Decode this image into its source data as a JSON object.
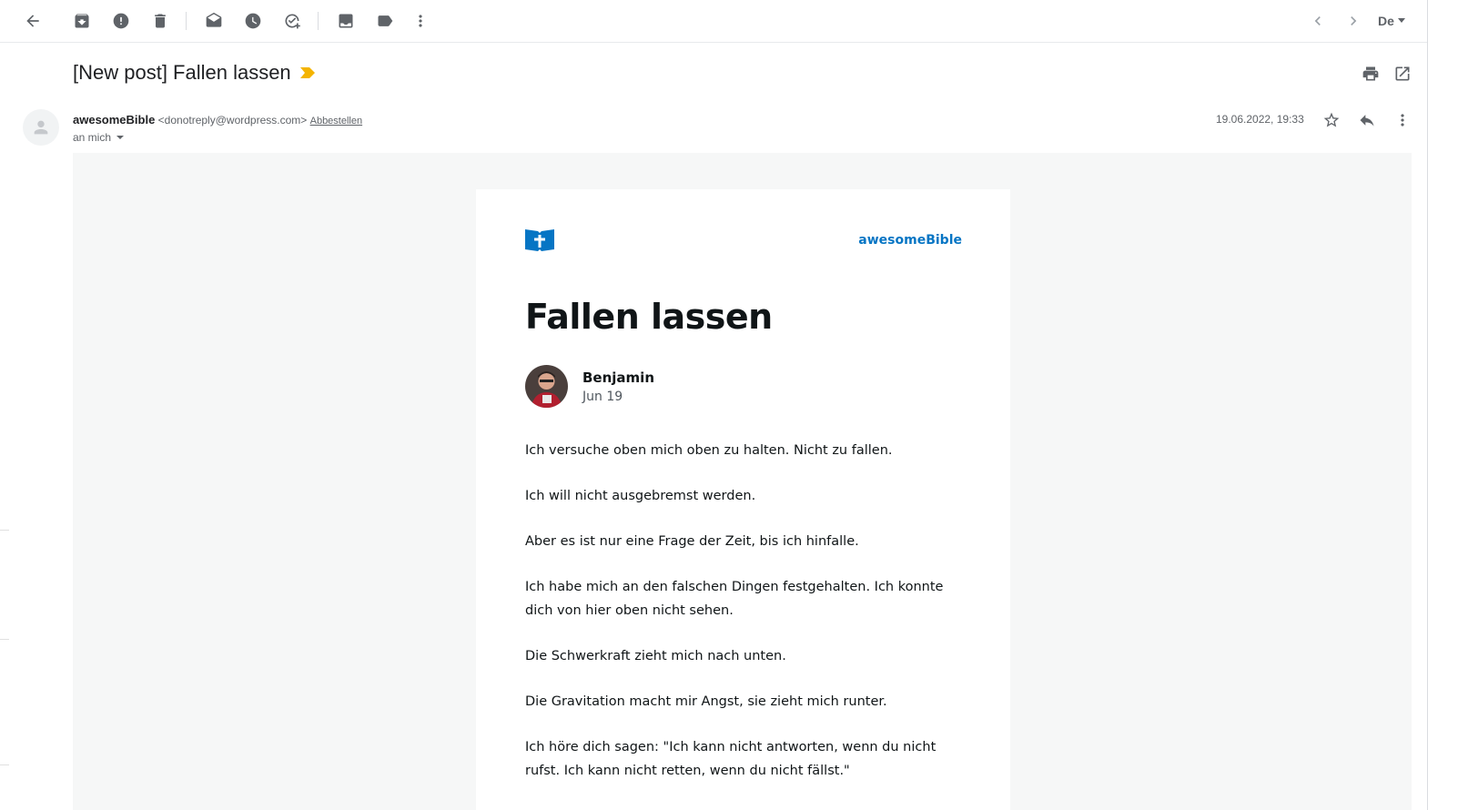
{
  "toolbar": {
    "buttons": [
      "back-icon",
      "archive-icon",
      "report-spam-icon",
      "delete-icon",
      "mark-unread-icon",
      "snooze-icon",
      "add-task-icon",
      "move-to-icon",
      "label-icon",
      "more-vert-icon"
    ],
    "language": "De"
  },
  "message": {
    "subject": "[New post] Fallen lassen",
    "sender_name": "awesomeBible",
    "sender_email": "<donotreply@wordpress.com>",
    "unsubscribe": "Abbestellen",
    "to": "an mich",
    "date": "19.06.2022, 19:33"
  },
  "post": {
    "brand": "awesomeBible",
    "title": "Fallen lassen",
    "author": "Benjamin",
    "date": "Jun 19",
    "paragraphs": [
      "Ich versuche oben mich oben zu halten. Nicht zu fallen.",
      "Ich will nicht ausgebremst werden.",
      "Aber es ist nur eine Frage der Zeit, bis ich hinfalle.",
      "Ich habe mich an den falschen Dingen festgehalten. Ich konnte dich von hier oben nicht sehen.",
      "Die Schwerkraft zieht mich nach unten.",
      "Die Gravitation macht mir Angst, sie zieht mich runter.",
      "Ich höre dich sagen: \"Ich kann nicht antworten, wenn du nicht rufst. Ich kann nicht retten, wenn du nicht fällst.\""
    ]
  },
  "colors": {
    "brand": "#0675c4",
    "importance": "#f4b400",
    "body_bg": "#f6f7f7"
  }
}
